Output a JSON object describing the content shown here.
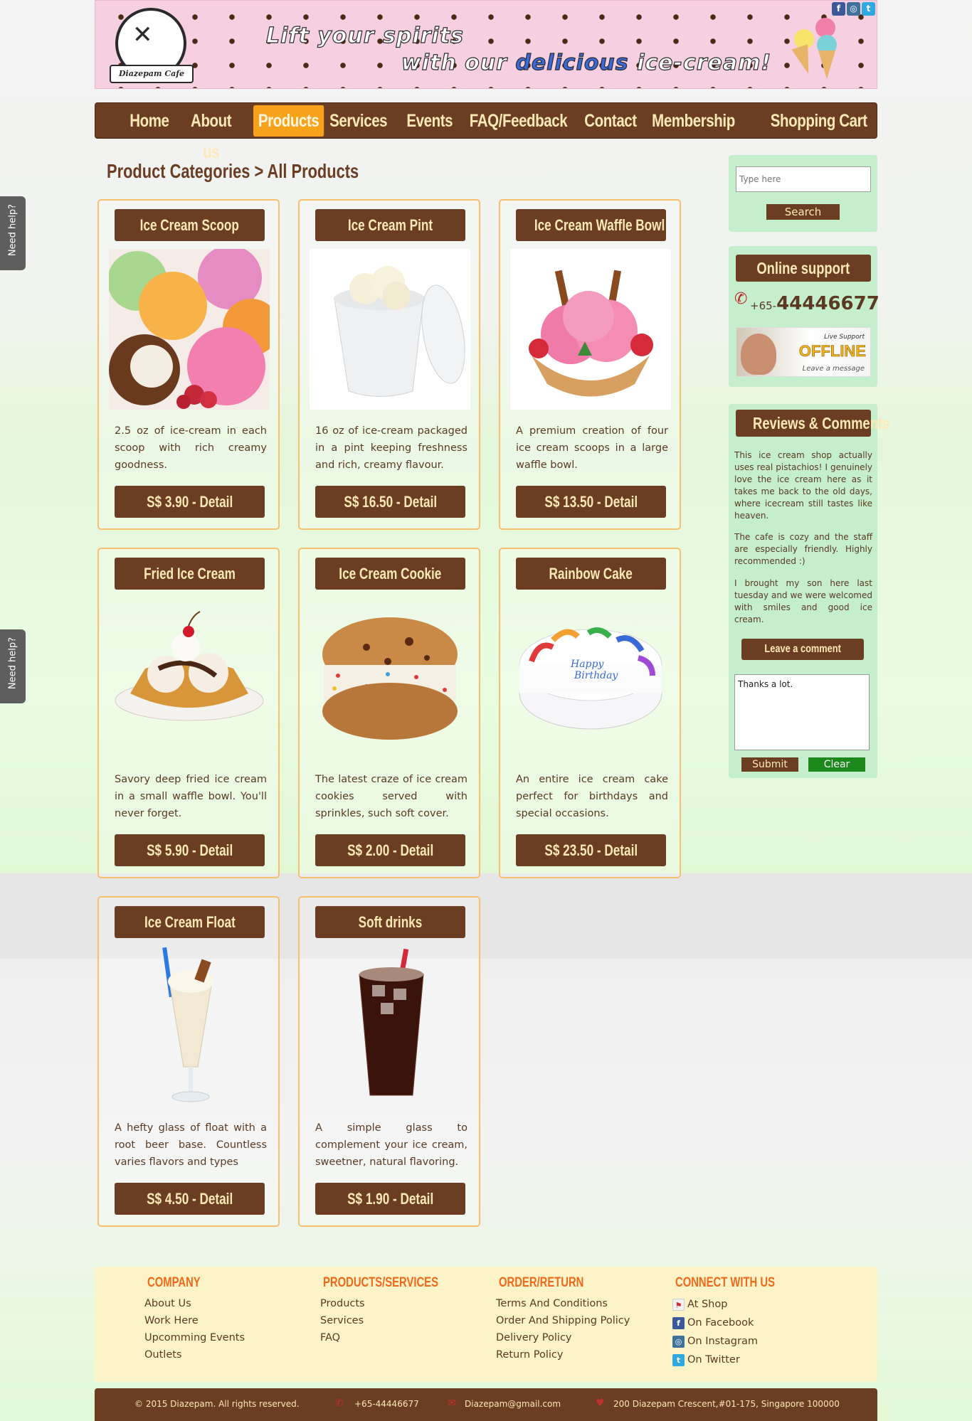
{
  "header": {
    "logo_text": "Diazepam Cafe",
    "slogan_line1": "Lift your spirits",
    "slogan_line2_pre": "with our",
    "slogan_line2_hl": "delicious",
    "slogan_line2_post": "ice-cream!"
  },
  "nav": {
    "items": [
      "Home",
      "About us",
      "Products",
      "Services",
      "Events",
      "FAQ/Feedback",
      "Contact",
      "Membership",
      "Shopping Cart"
    ],
    "active": "Products"
  },
  "breadcrumb": {
    "root": "Product Categories",
    "sep": ">",
    "current": "All Products"
  },
  "products": [
    {
      "title": "Ice Cream Scoop",
      "desc": "2.5 oz of ice-cream in each scoop with rich creamy goodness.",
      "price": "S$ 3.90 - Detail"
    },
    {
      "title": "Ice Cream Pint",
      "desc": "16 oz of ice-cream packaged in a pint keeping freshness and rich, creamy flavour.",
      "price": "S$ 16.50 - Detail"
    },
    {
      "title": "Ice Cream Waffle Bowl",
      "desc": "A premium creation of four ice cream scoops in a large waffle bowl.",
      "price": "S$ 13.50 - Detail"
    },
    {
      "title": "Fried Ice Cream",
      "desc": "Savory deep fried ice cream in a small waffle bowl. You'll never forget.",
      "price": "S$ 5.90 - Detail"
    },
    {
      "title": "Ice Cream Cookie",
      "desc": "The latest craze of ice cream cookies served with sprinkles, such soft cover.",
      "price": "S$ 2.00 - Detail"
    },
    {
      "title": "Rainbow Cake",
      "desc": "An entire ice cream cake perfect for birthdays and special occasions.",
      "price": "S$ 23.50 - Detail"
    },
    {
      "title": "Ice Cream Float",
      "desc": "A hefty glass of float with a root beer base. Countless varies flavors and types",
      "price": "S$ 4.50 - Detail"
    },
    {
      "title": "Soft drinks",
      "desc": "A simple glass to complement your ice cream, sweetner, natural flavoring.",
      "price": "S$ 1.90 - Detail"
    }
  ],
  "sidebar": {
    "search_placeholder": "Type here",
    "search_button": "Search",
    "support_title": "Online support",
    "phone_prefix": "+65-",
    "phone_number": "44446677",
    "live_support_label": "Live Support",
    "live_support_status": "OFFLINE",
    "live_support_action": "Leave a message",
    "reviews_title": "Reviews & Comments",
    "reviews": [
      "This ice cream shop actually uses real pistachios! I genuinely love the ice cream here as it takes me back to the old days, where icecream still tastes like heaven.",
      "The cafe is cozy and the staff are especially friendly. Highly recommended :)",
      "I brought my son here last tuesday and we were welcomed with smiles and good ice cream."
    ],
    "leave_comment": "Leave a comment",
    "comment_value": "Thanks a lot.",
    "submit": "Submit",
    "clear": "Clear"
  },
  "need_help": "Need help?",
  "footer": {
    "company_head": "COMPANY",
    "company_links": [
      "About Us",
      "Work Here",
      "Upcomming Events",
      "Outlets"
    ],
    "products_head": "PRODUCTS/SERVICES",
    "products_links": [
      "Products",
      "Services",
      "FAQ"
    ],
    "order_head": "ORDER/RETURN",
    "order_links": [
      "Terms And Conditions",
      "Order And Shipping Policy",
      "Delivery Policy",
      "Return Policy"
    ],
    "connect_head": "CONNECT WITH US",
    "connect_links": [
      "At Shop",
      "On Facebook",
      "On Instagram",
      "On Twitter"
    ]
  },
  "bottom_bar": {
    "copyright": "© 2015 Diazepam. All rights reserved.",
    "phone": "+65-44446677",
    "email": "Diazepam@gmail.com",
    "address": "200 Diazepam Crescent,#01-175, Singapore 100000"
  },
  "colors": {
    "brown": "#6b3d22",
    "nav_text": "#fde9b6",
    "active_tab": "#f7a21b",
    "sidebar_green": "#c5eecc",
    "footer_bg": "#fcf3c9",
    "footer_head": "#f06a1a",
    "card_border": "#f7bf6e",
    "clear_green": "#1b8a1b"
  }
}
